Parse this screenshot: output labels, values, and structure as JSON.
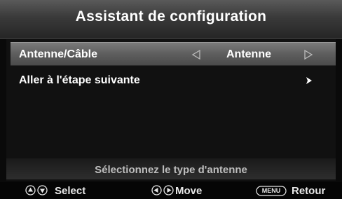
{
  "window": {
    "title": "Assistant de configuration"
  },
  "menu": {
    "items": [
      {
        "label": "Antenne/Câble",
        "value": "Antenne",
        "selected": true,
        "left_icon": "triangle-left-outline-icon",
        "right_icon": "triangle-right-outline-icon"
      },
      {
        "label": "Aller à l'étape suivante",
        "selected": false,
        "icon": "chevron-right-icon"
      }
    ]
  },
  "hint": {
    "text": "Sélectionnez le type d'antenne"
  },
  "footer": {
    "select_label": "Select",
    "move_label": "Move",
    "menu_key_label": "MENU",
    "back_label": "Retour"
  },
  "colors": {
    "background": "#0a0a0a",
    "title_bar": "#3a3a3a",
    "selected_row": "#6a6a6a",
    "text": "#ffffff",
    "hint_text": "#bdbdbd"
  }
}
